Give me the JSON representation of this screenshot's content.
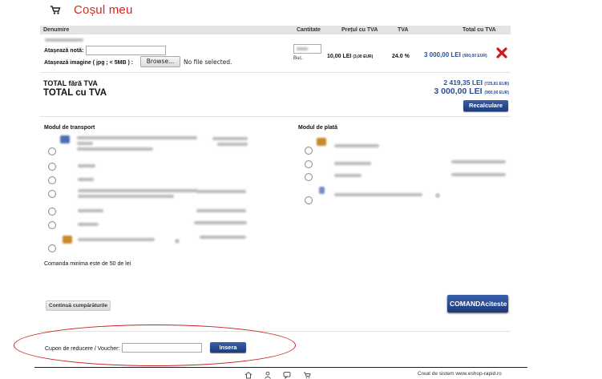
{
  "header": {
    "title": "Coșul meu",
    "icon": "cart-icon"
  },
  "table": {
    "columns": [
      "Denumire",
      "Cantitate",
      "Prețul cu TVA",
      "TVA",
      "Total cu TVA"
    ],
    "row": {
      "note_label": "Atașează notă:",
      "image_label": "Atașează imagine ( jpg ; < 5MB ) :",
      "browse_label": "Browse...",
      "file_status": "No file selected.",
      "unit": "Buc.",
      "unit_price": "10,00 LEI",
      "unit_price_eur": "(3,00 EUR)",
      "vat": "24.0 %",
      "total": "3 000,00 LEI",
      "total_eur": "(900,00 EUR)",
      "delete_icon": "delete-x-icon"
    }
  },
  "totals": {
    "net_label": "TOTAL fără TVA",
    "net_value": "2 419,35 LEI",
    "net_value_eur": "(725,81 EUR)",
    "gross_label": "TOTAL cu TVA",
    "gross_value": "3 000,00 LEI",
    "gross_value_eur": "(900,00 EUR)",
    "recalc_label": "Recalculare"
  },
  "transport": {
    "title": "Modul de transport"
  },
  "payment": {
    "title": "Modul de plată"
  },
  "min_order": "Comanda minima este de 50 de lei",
  "actions": {
    "continue_label": "Continuă cumpărăturile",
    "order_label": "COMANDAciteste"
  },
  "voucher": {
    "label": "Cupon de reducere / Voucher:",
    "button_label": "Insera",
    "value": ""
  },
  "footer": {
    "credit_prefix": "Creat de sistem",
    "credit_link": "www.eshop-rapid.ro"
  },
  "colors": {
    "accent_red": "#d9261c",
    "brand_blue": "#2b4e92",
    "button_blue": "#1d3a7b",
    "annotation_red": "#c8201b"
  }
}
